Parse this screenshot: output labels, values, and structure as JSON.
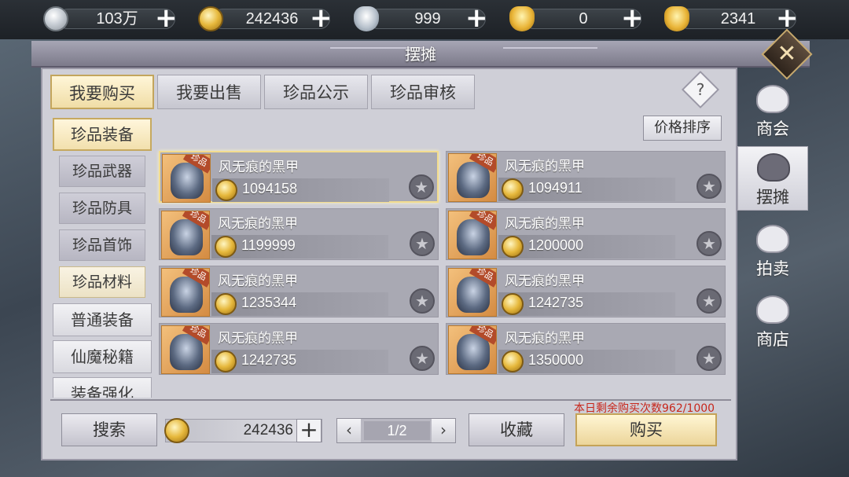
{
  "currencies": [
    {
      "icon": "silver-coin-icon",
      "value": "103万"
    },
    {
      "icon": "gold-coin-icon",
      "value": "242436"
    },
    {
      "icon": "silver-ingot-icon",
      "value": "999"
    },
    {
      "icon": "locked-gold-ingot-icon",
      "value": "0"
    },
    {
      "icon": "gold-ingot-icon",
      "value": "2341"
    }
  ],
  "plus_symbol": "+",
  "window": {
    "title": "摆摊",
    "close_symbol": "✕"
  },
  "tabs": [
    {
      "label": "我要购买",
      "active": true
    },
    {
      "label": "我要出售",
      "active": false
    },
    {
      "label": "珍品公示",
      "active": false
    },
    {
      "label": "珍品审核",
      "active": false
    }
  ],
  "help_symbol": "?",
  "categories": [
    {
      "label": "珍品装备",
      "type": "main",
      "active": true
    },
    {
      "label": "珍品武器",
      "type": "sub"
    },
    {
      "label": "珍品防具",
      "type": "sub"
    },
    {
      "label": "珍品首饰",
      "type": "sub"
    },
    {
      "label": "珍品材料",
      "type": "sub",
      "selected": true
    },
    {
      "label": "普通装备",
      "type": "main"
    },
    {
      "label": "仙魔秘籍",
      "type": "main"
    },
    {
      "label": "装备强化",
      "type": "main"
    }
  ],
  "sort_label": "价格排序",
  "items": [
    {
      "name": "风无痕的黑甲",
      "price": "1094158",
      "badge": "珍品",
      "selected": true
    },
    {
      "name": "风无痕的黑甲",
      "price": "1094911",
      "badge": "珍品"
    },
    {
      "name": "风无痕的黑甲",
      "price": "1199999",
      "badge": "珍品"
    },
    {
      "name": "风无痕的黑甲",
      "price": "1200000",
      "badge": "珍品"
    },
    {
      "name": "风无痕的黑甲",
      "price": "1235344",
      "badge": "珍品"
    },
    {
      "name": "风无痕的黑甲",
      "price": "1242735",
      "badge": "珍品"
    },
    {
      "name": "风无痕的黑甲",
      "price": "1242735",
      "badge": "珍品"
    },
    {
      "name": "风无痕的黑甲",
      "price": "1350000",
      "badge": "珍品"
    }
  ],
  "star_symbol": "★",
  "bottom": {
    "search_label": "搜索",
    "gold_value": "242436",
    "page": "1/2",
    "prev_symbol": "‹",
    "next_symbol": "›",
    "favorite_label": "收藏",
    "buy_label": "购买",
    "remaining_text": "本日剩余购买次数962/1000"
  },
  "sidenav": [
    {
      "label": "商会",
      "icon": "guild-icon",
      "active": false
    },
    {
      "label": "摆摊",
      "icon": "stall-bag-icon",
      "active": true
    },
    {
      "label": "拍卖",
      "icon": "auction-cards-icon",
      "active": false
    },
    {
      "label": "商店",
      "icon": "shop-ingot-icon",
      "active": false
    }
  ],
  "colors": {
    "accent_gold": "#f0dda6",
    "warning_red": "#c7271c",
    "panel": "#cfcfd7"
  }
}
